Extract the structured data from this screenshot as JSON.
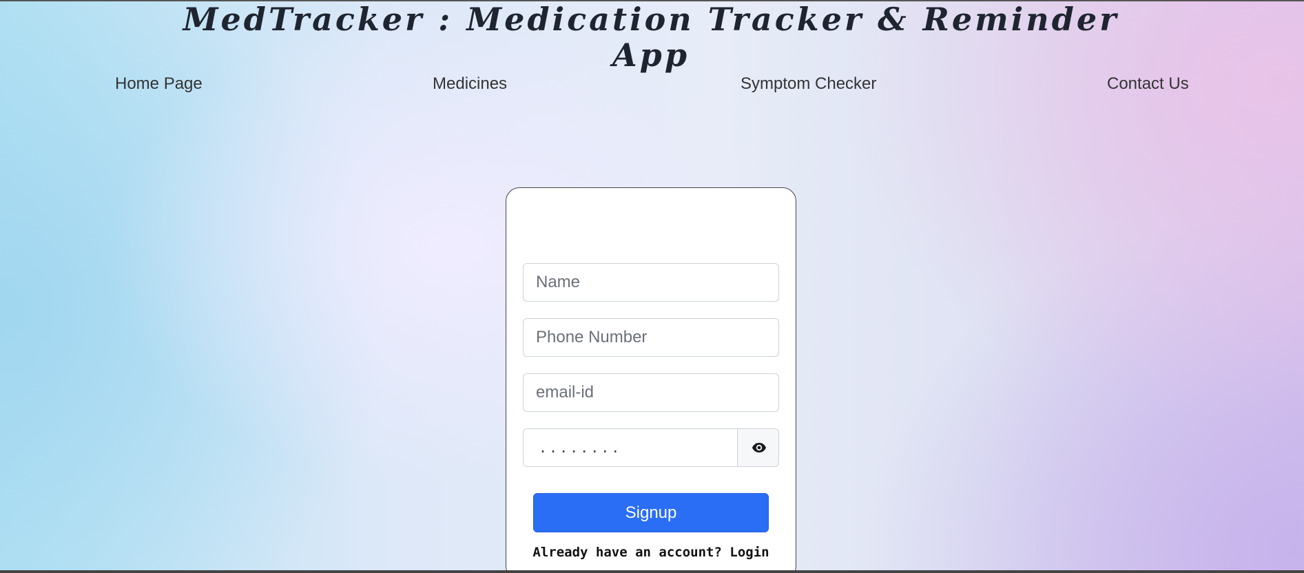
{
  "header": {
    "title": "MedTracker : Medication Tracker & Reminder App"
  },
  "nav": {
    "items": [
      {
        "label": "Home Page"
      },
      {
        "label": "Medicines"
      },
      {
        "label": "Symptom Checker"
      },
      {
        "label": "Contact Us"
      }
    ]
  },
  "signup_form": {
    "name_placeholder": "Name",
    "name_value": "",
    "phone_placeholder": "Phone Number",
    "phone_value": "",
    "email_placeholder": "email-id",
    "email_value": "",
    "password_value": "........",
    "password_toggle_icon": "eye-icon",
    "submit_label": "Signup",
    "account_prompt": "Already have an account?",
    "login_link": "Login"
  },
  "colors": {
    "primary_button": "#2b6ef6",
    "title_text": "#1f2530"
  }
}
